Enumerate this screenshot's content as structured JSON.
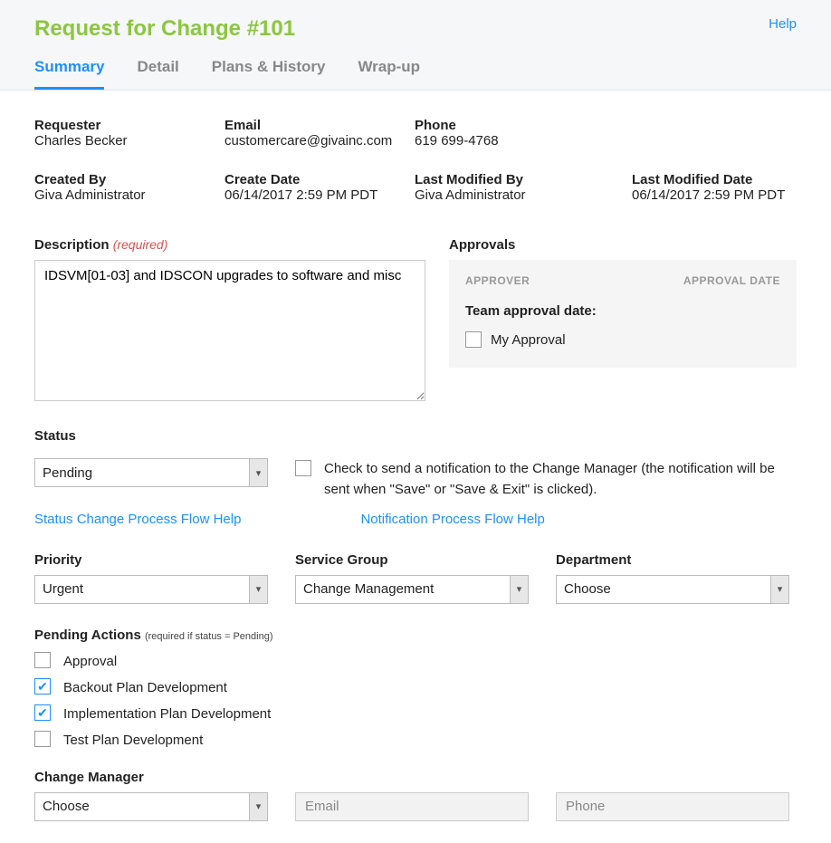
{
  "header": {
    "title": "Request for Change #101",
    "help": "Help",
    "tabs": [
      "Summary",
      "Detail",
      "Plans & History",
      "Wrap-up"
    ],
    "active_tab": 0
  },
  "info": {
    "requester": {
      "label": "Requester",
      "value": "Charles Becker"
    },
    "email": {
      "label": "Email",
      "value": "customercare@givainc.com"
    },
    "phone": {
      "label": "Phone",
      "value": "619 699-4768"
    },
    "created_by": {
      "label": "Created By",
      "value": "Giva Administrator"
    },
    "create_date": {
      "label": "Create Date",
      "value": "06/14/2017 2:59 PM PDT"
    },
    "last_mod_by": {
      "label": "Last Modified By",
      "value": "Giva Administrator"
    },
    "last_mod_date": {
      "label": "Last Modified Date",
      "value": "06/14/2017 2:59 PM PDT"
    }
  },
  "description": {
    "label": "Description",
    "required": "(required)",
    "value": "IDSVM[01-03] and IDSCON upgrades to software and misc"
  },
  "approvals": {
    "label": "Approvals",
    "h_approver": "APPROVER",
    "h_date": "APPROVAL DATE",
    "team_date": "Team approval date:",
    "my_approval": "My Approval"
  },
  "status": {
    "label": "Status",
    "value": "Pending",
    "notify_text": "Check to send a notification to the Change Manager (the notification will be sent when \"Save\" or \"Save & Exit\" is clicked).",
    "help_status": "Status Change Process Flow Help",
    "help_notify": "Notification Process Flow Help"
  },
  "priority": {
    "label": "Priority",
    "value": "Urgent"
  },
  "service_group": {
    "label": "Service Group",
    "value": "Change Management"
  },
  "department": {
    "label": "Department",
    "value": "Choose"
  },
  "pending_actions": {
    "label": "Pending Actions",
    "hint": "(required if status = Pending)",
    "items": [
      {
        "label": "Approval",
        "checked": false
      },
      {
        "label": "Backout Plan Development",
        "checked": true
      },
      {
        "label": "Implementation Plan Development",
        "checked": true
      },
      {
        "label": "Test Plan Development",
        "checked": false
      }
    ]
  },
  "change_manager": {
    "label": "Change Manager",
    "value": "Choose",
    "email_ph": "Email",
    "phone_ph": "Phone"
  }
}
